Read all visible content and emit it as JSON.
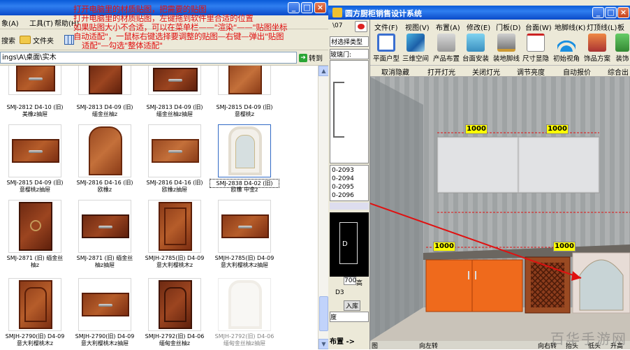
{
  "explorer": {
    "menu": [
      "象(A)",
      "工具(T)",
      "帮助(H)"
    ],
    "toolbar": {
      "search": "搜索",
      "folders": "文件夹"
    },
    "address": "ings\\A\\桌面\\实木",
    "go": "转到",
    "tiles": [
      {
        "name": "SMJ-2812 D4-10 (旧)",
        "sub": "美橡z抽屉"
      },
      {
        "name": "SMJ-2813 D4-09 (旧)",
        "sub": "缅金丝柚z"
      },
      {
        "name": "SMJ-2813 D4-09 (旧)",
        "sub": "缅金丝柚z抽屉"
      },
      {
        "name": "SMJ-2815 D4-09 (旧)",
        "sub": "意樱桃z"
      },
      {
        "name": "SMJ-2815 D4-09 (旧)",
        "sub": "意樱桃z抽屉"
      },
      {
        "name": "SMJ-2816 D4-16 (旧)",
        "sub": "欧橡z"
      },
      {
        "name": "SMJ-2816 D4-16 (旧)",
        "sub": "欧橡z抽屉"
      },
      {
        "name": "SMJ-2838 D4-02 (旧)",
        "sub": "欧橡 中金z"
      },
      {
        "name": "SMJ-2871 (旧) 缅金丝",
        "sub": "柚z"
      },
      {
        "name": "SMJ-2871 (旧) 缅金丝",
        "sub": "柚z抽屉"
      },
      {
        "name": "SMJH-2785(旧) D4-09",
        "sub": "意大利樱桃木z"
      },
      {
        "name": "SMJH-2785(旧) D4-09",
        "sub": "意大利樱桃木z抽屉"
      },
      {
        "name": "SMJH-2790(旧) D4-09",
        "sub": "意大利樱桃木z"
      },
      {
        "name": "SMJH-2790(旧) D4-09",
        "sub": "意大利樱桃木z抽屉"
      },
      {
        "name": "SMJH-2792(旧) D4-06",
        "sub": "缅甸金丝柚z"
      },
      {
        "name": "SMJH-2792(旧) D4-06",
        "sub": "缅甸金丝柚z抽屉"
      }
    ],
    "overlay_lines": [
      "打开电脑里的材质贴图，把需要的贴图",
      "打开电脑里的材质贴图，左键拖到软件里合适的位置",
      "如果贴图大小不合适，可以在菜单栏——\"渲染\"——\"贴图坐标",
      "自动适配\"，一鼠标右键选择要调整的贴图—右键—弹出\"贴图",
      "适配\"—勾选\"整体适配\""
    ]
  },
  "app": {
    "title": "圆方厨柜销售设计系统",
    "menu": [
      "文件(F)",
      "视图(V)",
      "布置(A)",
      "修改(E)",
      "门板(D)",
      "台面(W)",
      "地脚线(K)",
      "灯顶线(L)",
      "板件"
    ],
    "tools": [
      "平面户型",
      "三维空间",
      "产品布置",
      "台面安装",
      "装地脚线",
      "尺寸显隐",
      "初始视角",
      "饰品方案",
      "装饰"
    ],
    "actions": [
      "取消隐藏",
      "打开灯光",
      "关闭灯光",
      "调节亮度",
      "自动报价",
      "综合出"
    ],
    "left_panel": {
      "tab": "\\07",
      "category": "材选择类型",
      "door_label": "玻璃门:",
      "codes": [
        "0-2093",
        "0-2094",
        "0-2095",
        "0-2096"
      ],
      "height_label": "高",
      "height_value": "700",
      "d_label": "D",
      "d3_label": "D3",
      "stock_button": "入库",
      "degree_label": "度",
      "layout": "布置 ->"
    },
    "dims": [
      "1000",
      "1000",
      "1000",
      "1000"
    ],
    "status": [
      "图",
      "向左转",
      "向右转",
      "抬头",
      "低头",
      "升高"
    ]
  },
  "watermark": "百华手游网"
}
